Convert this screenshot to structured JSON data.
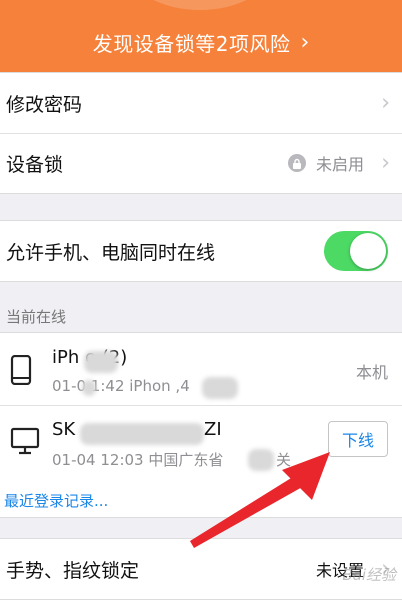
{
  "banner": {
    "text": "发现设备锁等2项风险",
    "chevron": "›"
  },
  "security": {
    "change_password": "修改密码",
    "device_lock": {
      "label": "设备锁",
      "value": "未启用",
      "icon": "lock-icon"
    }
  },
  "online_toggle": {
    "label": "允许手机、电脑同时在线",
    "on": true
  },
  "online_section": {
    "header": "当前在线",
    "devices": [
      {
        "icon": "phone-icon",
        "name": "iPh    e (2)",
        "detail": "01-0   1:42  iPhon     ,4",
        "tag": "本机"
      },
      {
        "icon": "monitor-icon",
        "name": "SK",
        "name_tail": "ZI",
        "detail": "01-04 12:03 中国广东省",
        "detail_tail": "关",
        "action": "下线"
      }
    ],
    "recent_link": "最近登录记录..."
  },
  "gesture": {
    "label": "手势、指纹锁定",
    "value": "未设置"
  },
  "colors": {
    "banner": "#f5813a",
    "toggle_on": "#4cd964",
    "link": "#1a86e8",
    "arrow": "#e8262c"
  },
  "watermark": "Bai经验"
}
